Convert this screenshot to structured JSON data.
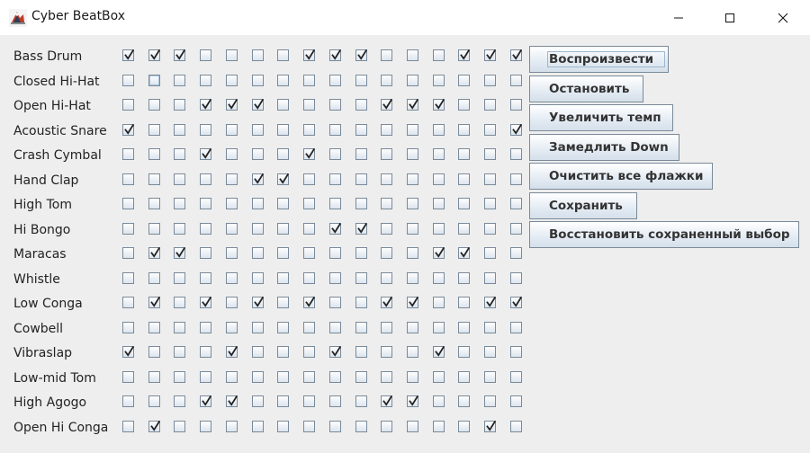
{
  "window": {
    "title": "Cyber BeatBox",
    "icon": "java-duke-icon",
    "controls": [
      "minimize-icon",
      "maximize-icon",
      "close-icon"
    ]
  },
  "instruments": [
    "Bass Drum",
    "Closed Hi-Hat",
    "Open Hi-Hat",
    "Acoustic Snare",
    "Crash Cymbal",
    "Hand Clap",
    "High Tom",
    "Hi Bongo",
    "Maracas",
    "Whistle",
    "Low Conga",
    "Cowbell",
    "Vibraslap",
    "Low-mid Tom",
    "High Agogo",
    "Open Hi Conga"
  ],
  "beats": 16,
  "grid": [
    [
      1,
      1,
      1,
      0,
      0,
      0,
      0,
      1,
      1,
      1,
      0,
      0,
      0,
      1,
      1,
      1
    ],
    [
      0,
      0,
      0,
      0,
      0,
      0,
      0,
      0,
      0,
      0,
      0,
      0,
      0,
      0,
      0,
      0
    ],
    [
      0,
      0,
      0,
      1,
      1,
      1,
      0,
      0,
      0,
      0,
      1,
      1,
      1,
      0,
      0,
      0
    ],
    [
      1,
      0,
      0,
      0,
      0,
      0,
      0,
      0,
      0,
      0,
      0,
      0,
      0,
      0,
      0,
      1
    ],
    [
      0,
      0,
      0,
      1,
      0,
      0,
      0,
      1,
      0,
      0,
      0,
      0,
      0,
      0,
      0,
      0
    ],
    [
      0,
      0,
      0,
      0,
      0,
      1,
      1,
      0,
      0,
      0,
      0,
      0,
      0,
      0,
      0,
      0
    ],
    [
      0,
      0,
      0,
      0,
      0,
      0,
      0,
      0,
      0,
      0,
      0,
      0,
      0,
      0,
      0,
      0
    ],
    [
      0,
      0,
      0,
      0,
      0,
      0,
      0,
      0,
      1,
      1,
      0,
      0,
      0,
      0,
      0,
      0
    ],
    [
      0,
      1,
      1,
      0,
      0,
      0,
      0,
      0,
      0,
      0,
      0,
      0,
      1,
      1,
      0,
      0
    ],
    [
      0,
      0,
      0,
      0,
      0,
      0,
      0,
      0,
      0,
      0,
      0,
      0,
      0,
      0,
      0,
      0
    ],
    [
      0,
      1,
      0,
      1,
      0,
      1,
      0,
      1,
      0,
      0,
      1,
      1,
      0,
      0,
      1,
      1
    ],
    [
      0,
      0,
      0,
      0,
      0,
      0,
      0,
      0,
      0,
      0,
      0,
      0,
      0,
      0,
      0,
      0
    ],
    [
      1,
      0,
      0,
      0,
      1,
      0,
      0,
      0,
      1,
      0,
      0,
      0,
      1,
      0,
      0,
      0
    ],
    [
      0,
      0,
      0,
      0,
      0,
      0,
      0,
      0,
      0,
      0,
      0,
      0,
      0,
      0,
      0,
      0
    ],
    [
      0,
      0,
      0,
      1,
      1,
      0,
      0,
      0,
      0,
      0,
      1,
      1,
      0,
      0,
      0,
      0
    ],
    [
      0,
      1,
      0,
      0,
      0,
      0,
      0,
      0,
      0,
      0,
      0,
      0,
      0,
      0,
      1,
      0
    ]
  ],
  "focused_checkbox": {
    "row": 1,
    "col": 1
  },
  "buttons": {
    "start": "Воспроизвести",
    "stop": "Остановить",
    "tempo_up": "Увеличить темп",
    "tempo_down": "Замедлить Down",
    "clear": "Очистить все флажки",
    "save": "Сохранить",
    "restore": "Восстановить сохраненный выбор"
  },
  "colors": {
    "background": "#eeeeee",
    "titlebar": "#ffffff",
    "checkbox_border": "#7a8a99",
    "check_mark": "#222222"
  }
}
